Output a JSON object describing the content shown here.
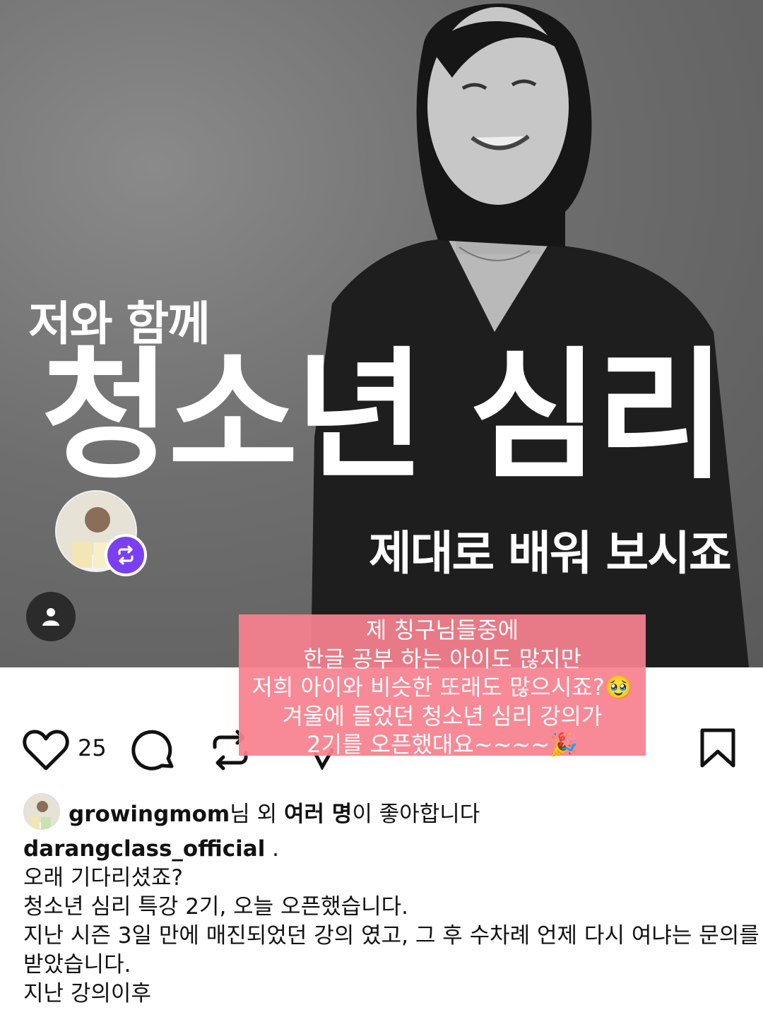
{
  "hero": {
    "line1": "저와 함께",
    "title": "청소년 심리",
    "line3": "제대로 배워 보시죠"
  },
  "sticker": {
    "lines": [
      "제 칭구님들중에",
      "한글 공부 하는 아이도 많지만",
      "저희 아이와 비슷한 또래도 많으시죠?🥹",
      "겨울에 들었던 청소년 심리 강의가",
      "2기를 오픈했대요~~~~🎉"
    ]
  },
  "actions": {
    "like_count": "25"
  },
  "liked_by": {
    "user": "growingmom",
    "middle": "님 외 ",
    "many": "여러 명",
    "suffix": "이 좋아합니다"
  },
  "caption": {
    "username": "darangclass_official",
    "separator": " .",
    "lines": [
      "오래 기다리셨죠?",
      "청소년 심리 특강 2기, 오늘 오픈했습니다.",
      "지난 시즌 3일 만에 매진되었던 강의 였고, 그 후 수차례 언제 다시 여냐는 문의를",
      "받았습니다.",
      "지난 강의이후"
    ]
  },
  "colors": {
    "sticker_bg": "#f8808e",
    "repost_badge": "#7b3ff2"
  }
}
